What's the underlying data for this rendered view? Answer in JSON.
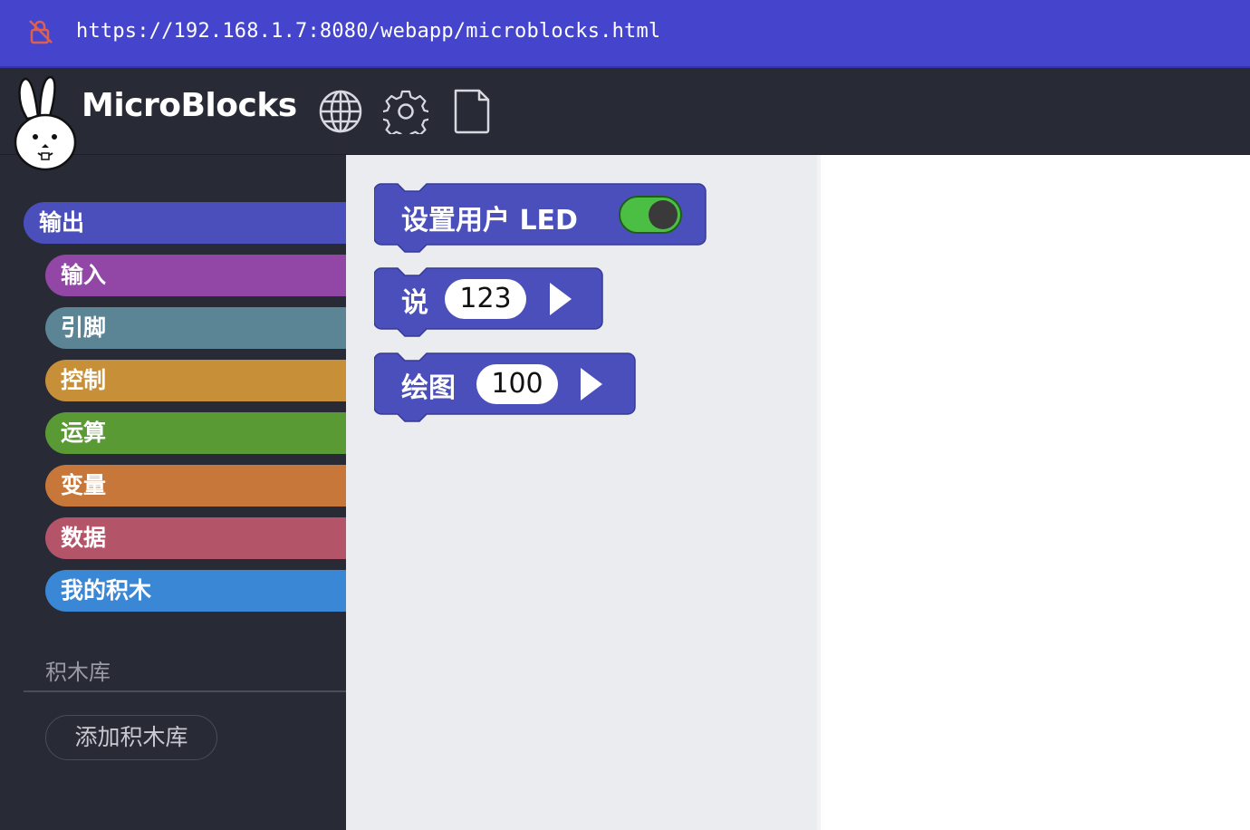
{
  "browser": {
    "url": "https://192.168.1.7:8080/webapp/microblocks.html"
  },
  "app": {
    "brand": "MicroBlocks"
  },
  "toolbar": {
    "icons": [
      "globe-icon",
      "gear-icon",
      "file-icon"
    ]
  },
  "sidebar": {
    "categories": [
      {
        "label": "输出",
        "color": "#4a4fbb"
      },
      {
        "label": "输入",
        "color": "#9247a7"
      },
      {
        "label": "引脚",
        "color": "#5b8494"
      },
      {
        "label": "控制",
        "color": "#c79038"
      },
      {
        "label": "运算",
        "color": "#5a9a35"
      },
      {
        "label": "变量",
        "color": "#c8773a"
      },
      {
        "label": "数据",
        "color": "#b45469"
      },
      {
        "label": "我的积木",
        "color": "#3a87d6"
      }
    ],
    "libraries_title": "积木库",
    "add_library_label": "添加积木库"
  },
  "palette": {
    "block_color": "#4a4fbb",
    "blocks": [
      {
        "label": "设置用户 LED",
        "toggle_on": true
      },
      {
        "label": "说",
        "value": "123"
      },
      {
        "label": "绘图",
        "value": "100"
      }
    ]
  }
}
